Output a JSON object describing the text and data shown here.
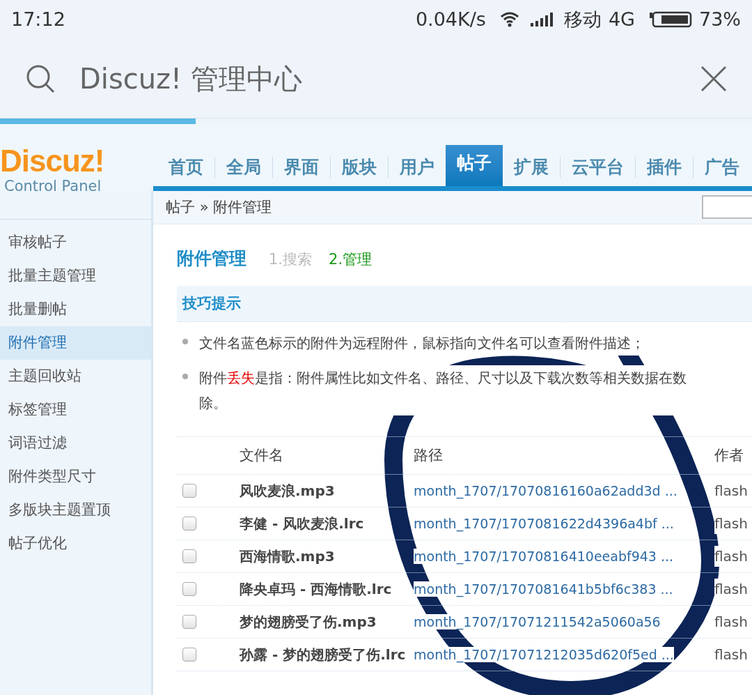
{
  "status_bar": {
    "time": "17:12",
    "speed": "0.04K/s",
    "carrier": "移动",
    "network": "4G",
    "battery": "73%"
  },
  "browser_bar": {
    "title": "Discuz! 管理中心",
    "load_progress": {
      "level": 0.26
    }
  },
  "logo": {
    "name": "Discuz!",
    "subtitle": "Control Panel"
  },
  "nav_tabs": [
    {
      "label": "首页",
      "selected": false
    },
    {
      "label": "全局",
      "selected": false
    },
    {
      "label": "界面",
      "selected": false
    },
    {
      "label": "版块",
      "selected": false
    },
    {
      "label": "用户",
      "selected": false
    },
    {
      "label": "帖子",
      "selected": true
    },
    {
      "label": "扩展",
      "selected": false
    },
    {
      "label": "云平台",
      "selected": false
    },
    {
      "label": "插件",
      "selected": false
    },
    {
      "label": "广告",
      "selected": false
    }
  ],
  "breadcrumb": "帖子 » 附件管理",
  "sidebar": {
    "items": [
      {
        "label": "审核帖子",
        "selected": false
      },
      {
        "label": "批量主题管理",
        "selected": false
      },
      {
        "label": "批量删帖",
        "selected": false
      },
      {
        "label": "附件管理",
        "selected": true
      },
      {
        "label": "主题回收站",
        "selected": false
      },
      {
        "label": "标签管理",
        "selected": false
      },
      {
        "label": "词语过滤",
        "selected": false
      },
      {
        "label": "附件类型尺寸",
        "selected": false
      },
      {
        "label": "多版块主题置顶",
        "selected": false
      },
      {
        "label": "帖子优化",
        "selected": false
      }
    ]
  },
  "page_title": "附件管理",
  "steps": [
    {
      "label": "1.搜索",
      "selected": false
    },
    {
      "label": "2.管理",
      "selected": true
    }
  ],
  "tips": {
    "title": "技巧提示",
    "items": [
      {
        "parts": [
          {
            "kind": "plain",
            "text": "文件名蓝色标示的附件为远程附件，鼠标指向文件名可以查看附件描述；"
          }
        ]
      },
      {
        "parts": [
          {
            "kind": "plain",
            "text": "附件"
          },
          {
            "kind": "warning",
            "text": "丢失"
          },
          {
            "kind": "plain",
            "text": "是指：附件属性比如文件名、路径、尺寸以及下载次数等相关数据在数"
          }
        ],
        "continuation": "除。"
      }
    ]
  },
  "table": {
    "columns": [
      "文件名",
      "路径",
      "作者"
    ],
    "rows": [
      {
        "checked": false,
        "name": "风吹麦浪.mp3",
        "path": "month_1707/17070816160a62add3d ...",
        "author": "flash"
      },
      {
        "checked": false,
        "name": "李健 - 风吹麦浪.lrc",
        "path": "month_1707/1707081622d4396a4bf ...",
        "author": "flash"
      },
      {
        "checked": false,
        "name": "西海情歌.mp3",
        "path": "month_1707/17070816410eeabf943 ...",
        "author": "flash"
      },
      {
        "checked": false,
        "name": "降央卓玛 - 西海情歌.lrc",
        "path": "month_1707/1707081641b5bf6c383 ...",
        "author": "flash"
      },
      {
        "checked": false,
        "name": "梦的翅膀受了伤.mp3",
        "path": "month_1707/17071211542a5060a56",
        "author": "flash"
      },
      {
        "checked": false,
        "name": "孙露 - 梦的翅膀受了伤.lrc",
        "path": "month_1707/17071212035d620f5ed ...",
        "author": "flash"
      }
    ]
  }
}
